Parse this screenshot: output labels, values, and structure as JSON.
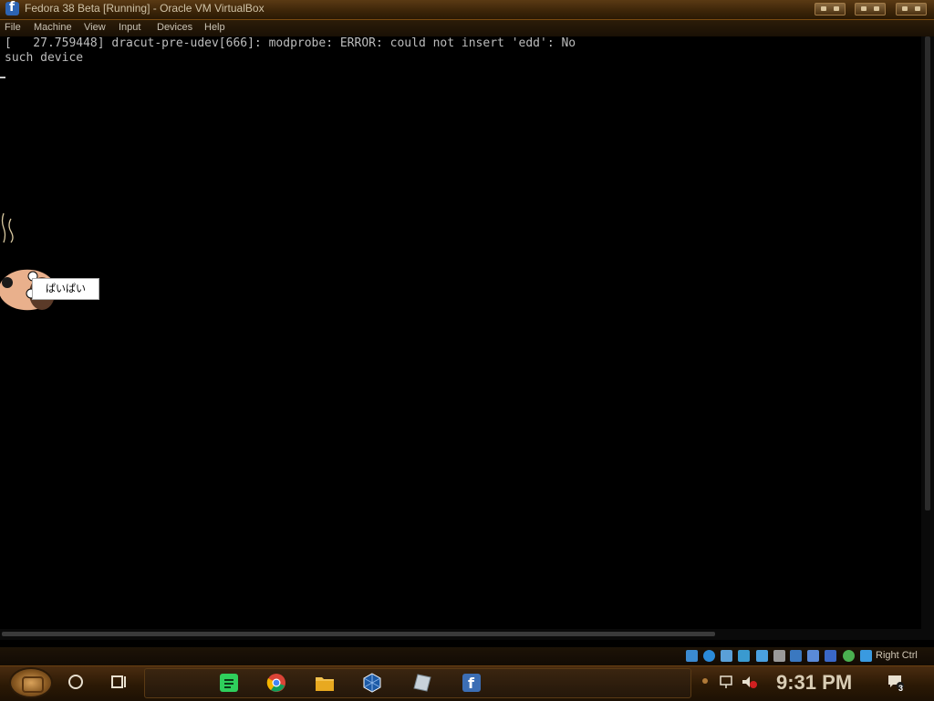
{
  "window": {
    "title": "Fedora 38 Beta [Running] - Oracle VM VirtualBox"
  },
  "menu": [
    "File",
    "Machine",
    "View",
    "Input",
    "Devices",
    "Help"
  ],
  "console": {
    "lines": [
      "[   27.759448] dracut-pre-udev[666]: modprobe: ERROR: could not insert 'edd': No",
      "such device"
    ]
  },
  "sticker": {
    "text": "ぱいぱい"
  },
  "statusbar": {
    "icons": [
      "hard-disk-icon",
      "optical-drive-icon",
      "audio-icon",
      "network-icon",
      "usb-icon",
      "shared-folders-icon",
      "display-icon",
      "recording-icon",
      "video-capture-icon",
      "cpu-icon",
      "mouse-integration-icon"
    ],
    "host_key": "Right Ctrl"
  },
  "taskbar": {
    "pinned": [
      "spotify-icon",
      "chrome-icon",
      "file-explorer-icon",
      "virtualbox-icon",
      "notepad-icon",
      "fedora-icon"
    ],
    "clock": "9:31 PM",
    "notification_count": "3",
    "colors": {
      "accent": "#e08a20",
      "title_text": "#cfc2a6"
    }
  }
}
